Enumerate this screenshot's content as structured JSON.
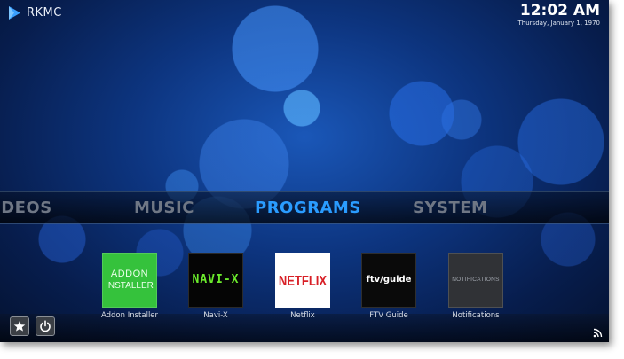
{
  "app": {
    "name": "RKMC"
  },
  "clock": {
    "time": "12:02 AM",
    "date": "Thursday, January 1, 1970"
  },
  "main_menu": {
    "items": [
      {
        "label": "IDEOS",
        "active": false
      },
      {
        "label": "MUSIC",
        "active": false
      },
      {
        "label": "PROGRAMS",
        "active": true
      },
      {
        "label": "SYSTEM",
        "active": false
      }
    ]
  },
  "addons": [
    {
      "label": "Addon Installer",
      "tile_line1": "ADDON",
      "tile_line2": "INSTALLER"
    },
    {
      "label": "Navi-X",
      "tile_line1": "NAVI-X"
    },
    {
      "label": "Netflix",
      "tile_line1": "NETFLIX"
    },
    {
      "label": "FTV Guide",
      "tile_line1": "ftv/guide"
    },
    {
      "label": "Notifications",
      "tile_line1": "NOTIFICATIONS"
    }
  ],
  "footer": {
    "favourites_icon": "star-icon",
    "power_icon": "power-icon",
    "rss_icon": "rss-icon"
  },
  "colors": {
    "accent": "#2a9cff",
    "inactive_menu": "#6f7785",
    "addon_green": "#35c23c",
    "netflix_red": "#d81f26"
  }
}
